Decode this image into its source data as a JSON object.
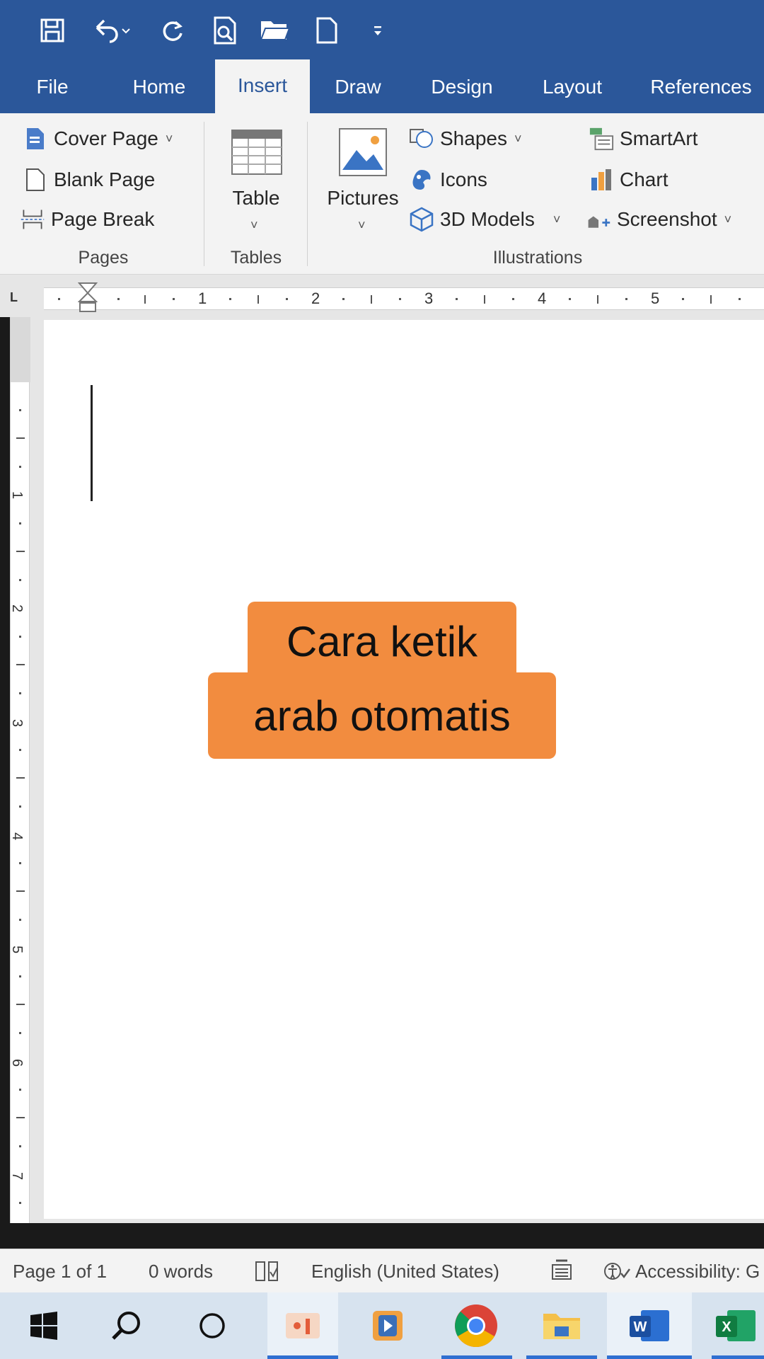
{
  "quick_access": {
    "icons": [
      "save-icon",
      "undo-icon",
      "redo-icon",
      "print-preview-icon",
      "open-folder-icon",
      "new-document-icon",
      "customize-qat-icon"
    ]
  },
  "tabs": [
    {
      "label": "File"
    },
    {
      "label": "Home"
    },
    {
      "label": "Insert"
    },
    {
      "label": "Draw"
    },
    {
      "label": "Design"
    },
    {
      "label": "Layout"
    },
    {
      "label": "References"
    }
  ],
  "ribbon": {
    "pages": {
      "cover_page": "Cover Page",
      "blank_page": "Blank Page",
      "page_break": "Page Break",
      "group": "Pages"
    },
    "tables": {
      "table": "Table",
      "group": "Tables"
    },
    "illustrations": {
      "pictures": "Pictures",
      "shapes": "Shapes",
      "icons": "Icons",
      "models_3d": "3D Models",
      "smartart": "SmartArt",
      "chart": "Chart",
      "screenshot": "Screenshot",
      "group": "Illustrations"
    }
  },
  "ruler": {
    "numbers": [
      "1",
      "2",
      "3",
      "4",
      "5"
    ],
    "corner": "L"
  },
  "vruler": {
    "numbers": [
      "1",
      "2",
      "3",
      "4",
      "5",
      "6",
      "7"
    ]
  },
  "overlay": {
    "line1": "Cara ketik",
    "line2": "arab otomatis"
  },
  "status": {
    "page": "Page 1 of 1",
    "words": "0 words",
    "language": "English (United States)",
    "accessibility": "Accessibility: G"
  },
  "taskbar": {
    "apps": [
      "start-icon",
      "search-icon",
      "task-view-icon",
      "presentation-app-icon",
      "media-app-icon",
      "chrome-icon",
      "file-explorer-icon",
      "word-icon",
      "excel-icon"
    ]
  }
}
